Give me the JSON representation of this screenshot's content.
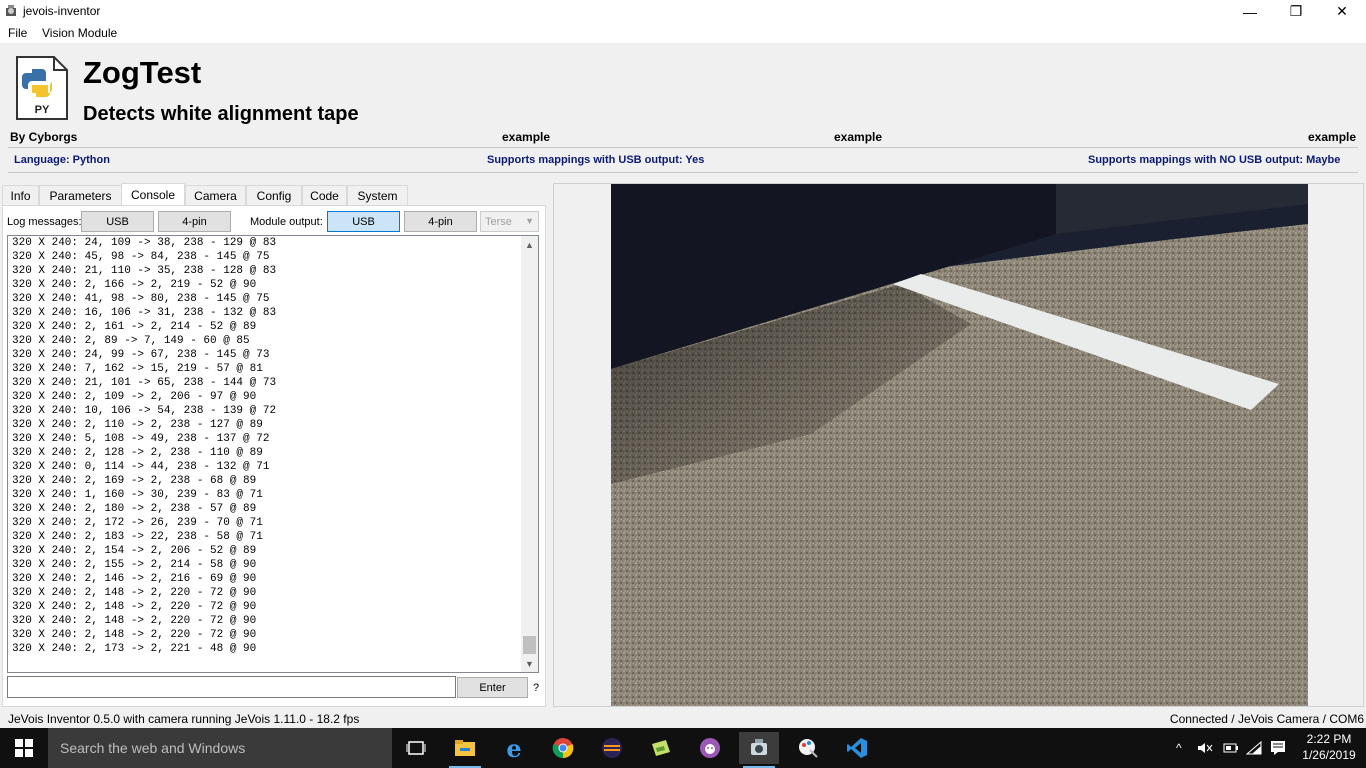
{
  "window": {
    "title": "jevois-inventor",
    "minimize": "—",
    "maximize": "❐",
    "close": "✕"
  },
  "menu": {
    "file": "File",
    "vision_module": "Vision Module"
  },
  "module": {
    "icon_label": "PY",
    "name": "ZogTest",
    "description": "Detects white alignment tape",
    "author": "By Cyborgs",
    "example1": "example",
    "example2": "example",
    "example3": "example",
    "language": "Language: Python",
    "usb_mapping": "Supports mappings with USB output: Yes",
    "no_usb_mapping": "Supports mappings with NO USB output: Maybe"
  },
  "tabs": [
    "Info",
    "Parameters",
    "Console",
    "Camera",
    "Config",
    "Code",
    "System"
  ],
  "active_tab": "Console",
  "console": {
    "log_label": "Log messages:",
    "log_usb": "USB",
    "log_4pin": "4-pin",
    "module_output_label": "Module output:",
    "out_usb": "USB",
    "out_4pin": "4-pin",
    "verbosity": "Terse",
    "enter": "Enter",
    "help": "?",
    "input_value": "",
    "lines": [
      "320 X 240: 24, 109 -> 38, 238 - 129 @ 83",
      "320 X 240: 45, 98 -> 84, 238 - 145 @ 75",
      "320 X 240: 21, 110 -> 35, 238 - 128 @ 83",
      "320 X 240: 2, 166 -> 2, 219 - 52 @ 90",
      "320 X 240: 41, 98 -> 80, 238 - 145 @ 75",
      "320 X 240: 16, 106 -> 31, 238 - 132 @ 83",
      "320 X 240: 2, 161 -> 2, 214 - 52 @ 89",
      "320 X 240: 2, 89 -> 7, 149 - 60 @ 85",
      "320 X 240: 24, 99 -> 67, 238 - 145 @ 73",
      "320 X 240: 7, 162 -> 15, 219 - 57 @ 81",
      "320 X 240: 21, 101 -> 65, 238 - 144 @ 73",
      "320 X 240: 2, 109 -> 2, 206 - 97 @ 90",
      "320 X 240: 10, 106 -> 54, 238 - 139 @ 72",
      "320 X 240: 2, 110 -> 2, 238 - 127 @ 89",
      "320 X 240: 5, 108 -> 49, 238 - 137 @ 72",
      "320 X 240: 2, 128 -> 2, 238 - 110 @ 89",
      "320 X 240: 0, 114 -> 44, 238 - 132 @ 71",
      "320 X 240: 2, 169 -> 2, 238 - 68 @ 89",
      "320 X 240: 1, 160 -> 30, 239 - 83 @ 71",
      "320 X 240: 2, 180 -> 2, 238 - 57 @ 89",
      "320 X 240: 2, 172 -> 26, 239 - 70 @ 71",
      "320 X 240: 2, 183 -> 22, 238 - 58 @ 71",
      "320 X 240: 2, 154 -> 2, 206 - 52 @ 89",
      "320 X 240: 2, 155 -> 2, 214 - 58 @ 90",
      "320 X 240: 2, 146 -> 2, 216 - 69 @ 90",
      "320 X 240: 2, 148 -> 2, 220 - 72 @ 90",
      "320 X 240: 2, 148 -> 2, 220 - 72 @ 90",
      "320 X 240: 2, 148 -> 2, 220 - 72 @ 90",
      "320 X 240: 2, 148 -> 2, 220 - 72 @ 90",
      "320 X 240: 2, 173 -> 2, 221 - 48 @ 90"
    ]
  },
  "status": {
    "left": "JeVois Inventor 0.5.0 with camera running JeVois 1.11.0 - 18.2 fps",
    "right": "Connected / JeVois Camera / COM6"
  },
  "taskbar": {
    "search_placeholder": "Search the web and Windows",
    "time": "2:22 PM",
    "date": "1/26/2019",
    "apps": [
      "task-view-icon",
      "file-explorer-icon",
      "edge-icon",
      "chrome-icon",
      "eclipse-icon",
      "notepad-icon",
      "github-icon",
      "jevois-inventor-icon",
      "paint-icon",
      "vscode-icon"
    ]
  },
  "colors": {
    "accent": "#0078d7",
    "taskbar": "#101010",
    "link_blue": "#0a1a7a"
  }
}
